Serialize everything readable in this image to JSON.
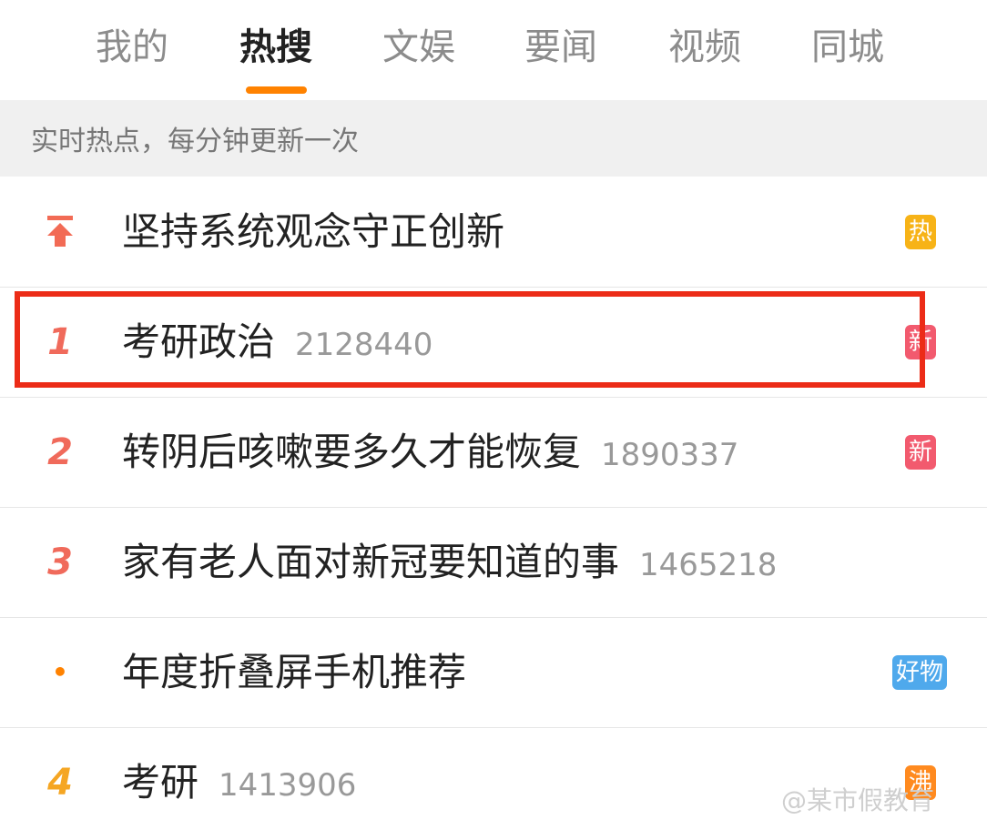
{
  "tabs": [
    {
      "label": "我的"
    },
    {
      "label": "热搜"
    },
    {
      "label": "文娱"
    },
    {
      "label": "要闻"
    },
    {
      "label": "视频"
    },
    {
      "label": "同城"
    }
  ],
  "active_tab": "热搜",
  "notice": "实时热点，每分钟更新一次",
  "list": [
    {
      "rank": "",
      "rank_icon": "pin-top-arrow-icon",
      "title": "坚持系统观念守正创新",
      "count": "",
      "badge": "热",
      "badge_color": "#f7b317"
    },
    {
      "rank": "1",
      "title": "考研政治",
      "count": "2128440",
      "badge": "新",
      "badge_color": "#f25a6e"
    },
    {
      "rank": "2",
      "title": "转阴后咳嗽要多久才能恢复",
      "count": "1890337",
      "badge": "新",
      "badge_color": "#f25a6e"
    },
    {
      "rank": "3",
      "title": "家有老人面对新冠要知道的事",
      "count": "1465218",
      "badge": "",
      "badge_color": ""
    },
    {
      "rank": "•",
      "title": "年度折叠屏手机推荐",
      "count": "",
      "badge": "好物",
      "badge_color": "#4fa9ec"
    },
    {
      "rank": "4",
      "title": "考研",
      "count": "1413906",
      "badge": "沸",
      "badge_color": "#ff8a1f"
    }
  ],
  "highlight_color": "#ec2c17",
  "accent_color": "#ff8200",
  "watermark": "@某市假教育"
}
